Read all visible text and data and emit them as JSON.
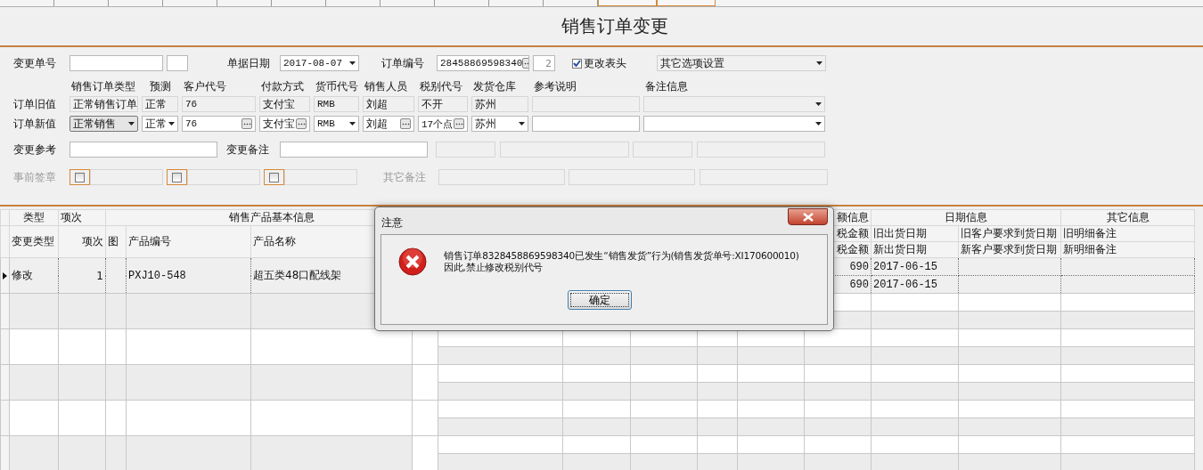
{
  "window": {
    "title": "销售订单变更"
  },
  "form": {
    "change_no": {
      "label": "变更单号"
    },
    "doc_date": {
      "label": "单据日期",
      "value": "2017-08-07"
    },
    "order_no": {
      "label": "订单编号",
      "value": "28458869598340",
      "seq": "2"
    },
    "change_header": {
      "label": "更改表头",
      "checked": true
    },
    "other_options": {
      "value": "其它选项设置"
    },
    "columns": [
      "销售订单类型",
      "预测",
      "客户代号",
      "付款方式",
      "货币代号",
      "销售人员",
      "税别代号",
      "发货仓库",
      "参考说明",
      "备注信息"
    ],
    "old_row": {
      "label": "订单旧值",
      "cells": [
        {
          "kind": "readonly",
          "value": "正常销售订单"
        },
        {
          "kind": "readonly",
          "value": "正常"
        },
        {
          "kind": "readonly",
          "value": "76"
        },
        {
          "kind": "readonly",
          "value": "支付宝"
        },
        {
          "kind": "readonly",
          "value": "RMB"
        },
        {
          "kind": "readonly",
          "value": "刘超"
        },
        {
          "kind": "readonly",
          "value": "不开"
        },
        {
          "kind": "readonly",
          "value": "苏州"
        },
        {
          "kind": "readonly"
        },
        {
          "kind": "readonly-dropdown"
        }
      ]
    },
    "new_row": {
      "label": "订单新值",
      "cells": [
        {
          "kind": "combo",
          "value": "正常销售"
        },
        {
          "kind": "dropdown",
          "value": "正常"
        },
        {
          "kind": "lookup",
          "value": "76"
        },
        {
          "kind": "lookup",
          "value": "支付宝"
        },
        {
          "kind": "dropdown",
          "value": "RMB"
        },
        {
          "kind": "lookup",
          "value": "刘超"
        },
        {
          "kind": "lookup",
          "value": "17个点"
        },
        {
          "kind": "dropdown",
          "value": "苏州"
        },
        {
          "kind": "text"
        },
        {
          "kind": "dropdown"
        }
      ]
    },
    "change_ref": {
      "label": "变更参考"
    },
    "change_note": {
      "label": "变更备注"
    },
    "signature": {
      "label": "事前签章",
      "disabled": true,
      "stamps": [
        {
          "checked": false
        },
        {
          "checked": false
        },
        {
          "checked": false
        }
      ]
    },
    "other_note": {
      "label": "其它备注",
      "disabled": true
    }
  },
  "grid": {
    "group_headers": [
      "类型",
      "项次",
      "销售产品基本信息",
      "额信息",
      "日期信息",
      "其它信息"
    ],
    "left_columns": [
      "变更类型",
      "项次",
      "图",
      "产品编号",
      "产品名称"
    ],
    "old_columns": [
      "税金额",
      "旧出货日期",
      "旧客户要求到货日期",
      "旧明细备注"
    ],
    "new_columns": [
      "税金额",
      "新出货日期",
      "新客户要求到货日期",
      "新明细备注"
    ],
    "rows": [
      {
        "selected": true,
        "change_type": "修改",
        "item": "1",
        "code": "PXJ10-548",
        "name": "超五类48口配线架",
        "lines": [
          {
            "amount": "690",
            "ship_date": "2017-06-15"
          },
          {
            "amount": "690",
            "ship_date": "2017-06-15"
          }
        ]
      }
    ]
  },
  "dialog": {
    "title": "注意",
    "message": [
      "销售订单8328458869598340已发生“销售发货”行为(销售发货单号:XI170600010)",
      "因此,禁止修改税别代号"
    ],
    "button": "确定"
  }
}
